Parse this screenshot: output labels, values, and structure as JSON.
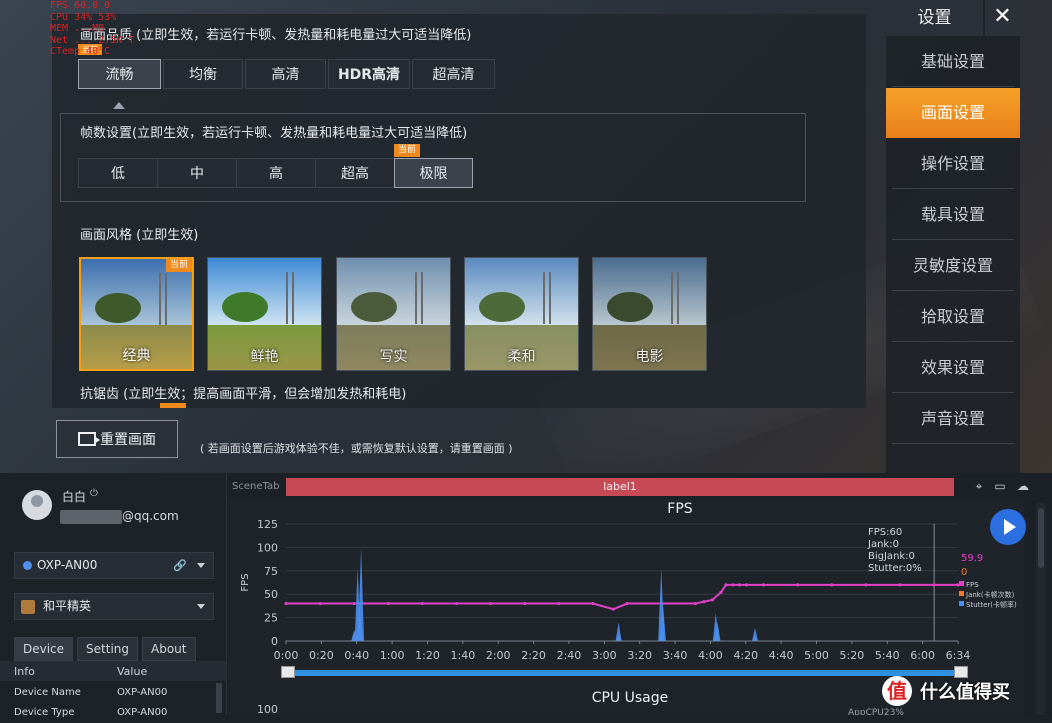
{
  "game": {
    "overlay": {
      "fps_line": "FPS  60.0   0",
      "cpu_line": "CPU  34%  53%",
      "mem_line": "MEM  ...MB",
      "net_line": "Net  ...  2.5K T",
      "temp_line": "CTemp  40°C"
    },
    "quality": {
      "title": "画面品质 (立即生效，若运行卡顿、发热量和耗电量过大可适当降低)",
      "options": [
        "流畅",
        "均衡",
        "高清",
        "HDR高清",
        "超高清"
      ],
      "selected": 0,
      "small_badge": "当前"
    },
    "framerate": {
      "title": "帧数设置(立即生效，若运行卡顿、发热量和耗电量过大可适当降低)",
      "options": [
        "低",
        "中",
        "高",
        "超高",
        "极限"
      ],
      "selected": 4,
      "badge": "当前"
    },
    "style": {
      "title": "画面风格 (立即生效)",
      "options": [
        "经典",
        "鲜艳",
        "写实",
        "柔和",
        "电影"
      ],
      "selected": 0,
      "badge": "当前"
    },
    "antialias": {
      "title": "抗锯齿 (立即生效；提高画面平滑，但会增加发热和耗电)"
    },
    "reset": {
      "label": "重置画面",
      "hint": "( 若画面设置后游戏体验不佳，或需恢复默认设置，请重置画面 )"
    },
    "sidebar": {
      "title": "设置",
      "close": "✕",
      "items": [
        "基础设置",
        "画面设置",
        "操作设置",
        "载具设置",
        "灵敏度设置",
        "拾取设置",
        "效果设置",
        "声音设置"
      ],
      "active": 1
    }
  },
  "tool": {
    "user": {
      "name": "白白",
      "power_icon": "⏻",
      "email_suffix": "@qq.com"
    },
    "device_dropdown": {
      "value": "OXP-AN00",
      "link_icon": "🔗"
    },
    "game_dropdown": {
      "value": "和平精英"
    },
    "tabs": [
      "Device",
      "Setting",
      "About"
    ],
    "info_header": {
      "k": "Info",
      "v": "Value"
    },
    "info_rows": [
      {
        "k": "Device Name",
        "v": "OXP-AN00"
      },
      {
        "k": "Device Type",
        "v": "OXP-AN00"
      }
    ],
    "scene_tab_label": "SceneTab",
    "scene_bar_label": "label1",
    "icons": [
      "location-icon",
      "folder-icon",
      "cloud-icon"
    ],
    "stats": {
      "fps": "FPS:60",
      "jank": "Jank:0",
      "bigjank": "BigJank:0",
      "stutter": "Stutter:0%"
    },
    "current_values": {
      "fps": "59.9",
      "jank": "0"
    },
    "legend": [
      "FPS",
      "Jank(卡顿次数)",
      "Stutter(卡顿率)"
    ],
    "cpu_chart": {
      "title": "CPU Usage",
      "first_tick": "100",
      "corner_text": "AppCPU23%"
    },
    "watermark": {
      "logo": "值",
      "text": "什么值得买"
    }
  },
  "colors": {
    "accent": "#f39b22",
    "fps_line": "#e040c8",
    "jank": "#f07a2a",
    "stutter": "#4a8ff0",
    "scene_bar": "#c74a57"
  },
  "chart_data": {
    "type": "line",
    "title": "FPS",
    "xlabel": "",
    "ylabel": "FPS",
    "ylim": [
      0,
      125
    ],
    "yticks": [
      0,
      25,
      50,
      75,
      100,
      125
    ],
    "xticks": [
      "0:00",
      "0:20",
      "0:40",
      "1:00",
      "1:20",
      "1:40",
      "2:00",
      "2:20",
      "2:40",
      "3:00",
      "3:20",
      "3:40",
      "4:00",
      "4:20",
      "4:40",
      "5:00",
      "5:20",
      "5:40",
      "6:00",
      "6:34"
    ],
    "x_seconds_max": 394,
    "series": [
      {
        "name": "FPS",
        "x": [
          0,
          20,
          40,
          60,
          80,
          100,
          120,
          140,
          160,
          180,
          192,
          200,
          220,
          240,
          245,
          250,
          255,
          258,
          262,
          266,
          270,
          280,
          300,
          320,
          340,
          360,
          380,
          394
        ],
        "values": [
          40,
          40,
          40,
          40,
          40,
          40,
          40,
          40,
          40,
          40,
          34,
          40,
          40,
          40,
          42,
          44,
          52,
          60,
          60,
          60,
          60,
          60,
          60,
          60,
          60,
          60,
          60,
          60
        ]
      },
      {
        "name": "Jank(卡顿次数)",
        "x": [
          40,
          42,
          44,
          195,
          220,
          252,
          275
        ],
        "values": [
          8,
          10,
          6,
          6,
          8,
          6,
          4
        ]
      },
      {
        "name": "Stutter(卡顿率)",
        "x": [
          40,
          42,
          43,
          44,
          195,
          220,
          221,
          252,
          253,
          275
        ],
        "values": [
          12,
          78,
          40,
          100,
          20,
          78,
          40,
          30,
          20,
          14
        ]
      }
    ]
  }
}
